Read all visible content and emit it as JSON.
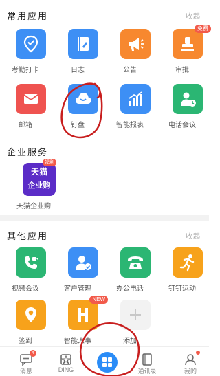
{
  "sections": {
    "common": {
      "title": "常用应用",
      "collapse": "收起"
    },
    "enterprise": {
      "title": "企业服务"
    },
    "other": {
      "title": "其他应用",
      "collapse": "收起"
    }
  },
  "common_apps": [
    {
      "label": "考勤打卡",
      "icon": "location-check-icon",
      "color": "#3d8ff5"
    },
    {
      "label": "日志",
      "icon": "journal-icon",
      "color": "#3d8ff5"
    },
    {
      "label": "公告",
      "icon": "megaphone-icon",
      "color": "#f7882f"
    },
    {
      "label": "审批",
      "icon": "stamp-icon",
      "color": "#f7882f",
      "badge": "免费"
    },
    {
      "label": "邮箱",
      "icon": "mail-icon",
      "color": "#ef5350"
    },
    {
      "label": "钉盘",
      "icon": "cloud-icon",
      "color": "#3d8ff5"
    },
    {
      "label": "智能报表",
      "icon": "chart-icon",
      "color": "#3d8ff5"
    },
    {
      "label": "电话会议",
      "icon": "phone-conference-icon",
      "color": "#2bb673"
    }
  ],
  "enterprise_apps": [
    {
      "label": "天猫企业购",
      "icon_top": "天猫",
      "icon_bottom": "企业购",
      "badge": "福利",
      "color": "#5b2cc7"
    }
  ],
  "other_apps": [
    {
      "label": "视频会议",
      "icon": "video-call-icon",
      "color": "#2bb673"
    },
    {
      "label": "客户管理",
      "icon": "customer-icon",
      "color": "#3d8ff5"
    },
    {
      "label": "办公电话",
      "icon": "telephone-icon",
      "color": "#2bb673"
    },
    {
      "label": "钉钉运动",
      "icon": "runner-icon",
      "color": "#f7a21b"
    },
    {
      "label": "签到",
      "icon": "pin-icon",
      "color": "#f7a21b"
    },
    {
      "label": "智能人事",
      "icon": "hr-icon",
      "color": "#f7a21b",
      "badge": "NEW"
    },
    {
      "label": "添加",
      "icon": "plus-icon",
      "color": "#f2f2f2"
    }
  ],
  "tabbar": [
    {
      "label": "消息",
      "icon": "chat-icon",
      "badge": "4"
    },
    {
      "label": "DING",
      "icon": "ding-icon"
    },
    {
      "label": "",
      "icon": "grid-icon",
      "center": true
    },
    {
      "label": "通讯录",
      "icon": "contacts-icon"
    },
    {
      "label": "我的",
      "icon": "profile-icon",
      "dot": true
    }
  ]
}
